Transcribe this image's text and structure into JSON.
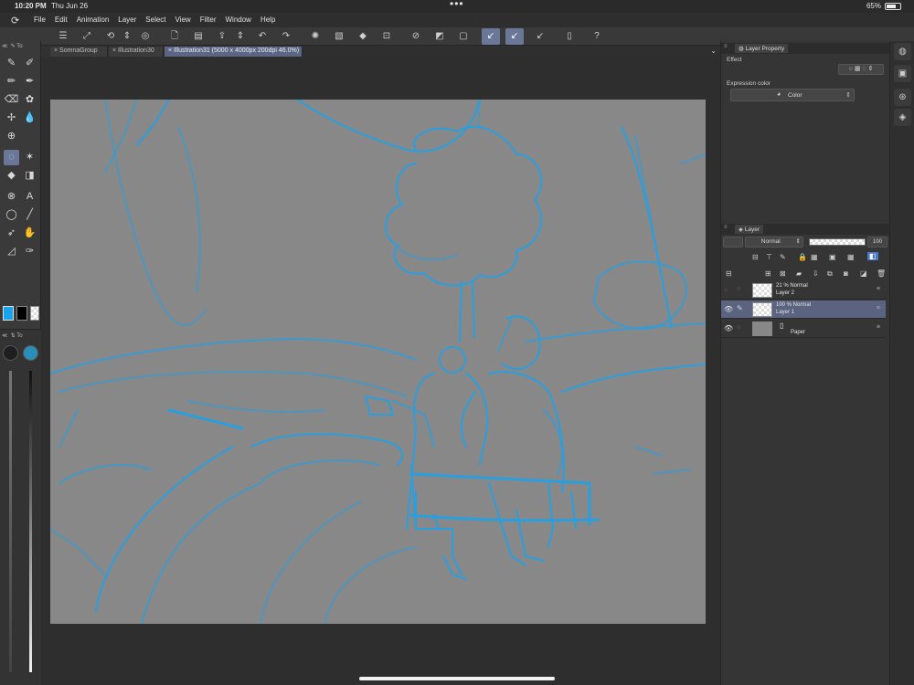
{
  "status": {
    "time": "10:20 PM",
    "date": "Thu Jun 26",
    "dots": "•••",
    "battery": "65%"
  },
  "menu": {
    "items": [
      "File",
      "Edit",
      "Animation",
      "Layer",
      "Select",
      "View",
      "Filter",
      "Window",
      "Help"
    ]
  },
  "tabs": [
    {
      "label": "SomnaGroup"
    },
    {
      "label": "Illustration30"
    },
    {
      "label": "Illustration31 (5000 x 4000px 200dpi 46.0%)"
    }
  ],
  "left_tools": {
    "header": "To"
  },
  "left_sub": {
    "header": "To"
  },
  "layer_property": {
    "title": "Layer Property",
    "effect_label": "Effect",
    "expression_label": "Expression color",
    "expression_value": "Color"
  },
  "layer_panel": {
    "title": "Layer",
    "blend_mode": "Normal",
    "opacity": "100",
    "layers": [
      {
        "line1": "21 %  Normal",
        "line2": "Layer 2"
      },
      {
        "line1": "100 %  Normal",
        "line2": "Layer 1"
      },
      {
        "line1": "",
        "line2": "Paper"
      }
    ]
  },
  "colors": {
    "accent": "#6a7798",
    "main_color": "#1aa3ea",
    "sketch_line": "#2a9fe0",
    "canvas": "#888888"
  }
}
